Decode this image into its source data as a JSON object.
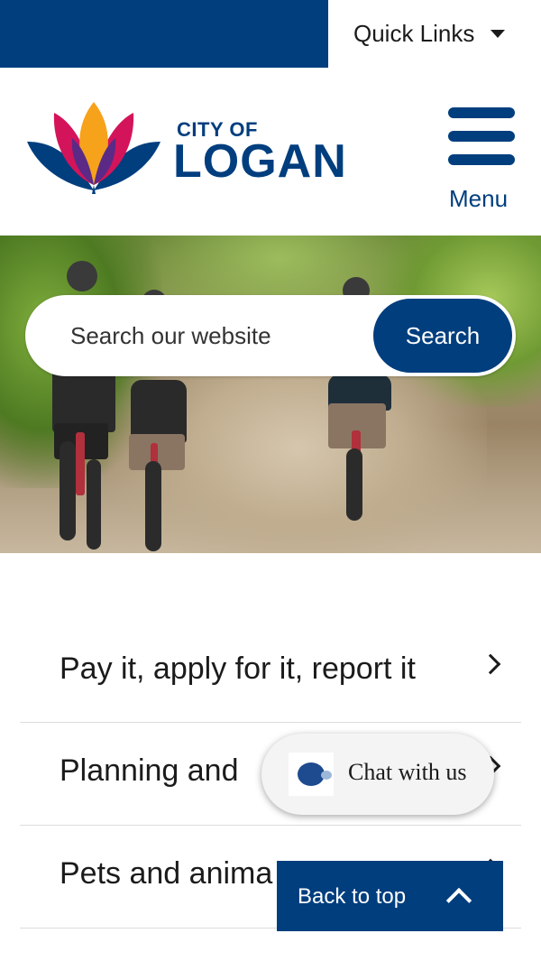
{
  "topbar": {
    "quick_links_label": "Quick Links"
  },
  "header": {
    "logo_city": "CITY OF",
    "logo_name": "LOGAN",
    "menu_label": "Menu"
  },
  "search": {
    "placeholder": "Search our website",
    "button_label": "Search"
  },
  "links": [
    {
      "label": "Pay it, apply for it, report it"
    },
    {
      "label": "Planning and"
    },
    {
      "label": "Pets and anima"
    }
  ],
  "chat": {
    "label": "Chat with us"
  },
  "back_to_top": {
    "label": "Back to top"
  },
  "colors": {
    "brand_blue": "#003e7e",
    "logo_pink": "#d4145a",
    "logo_orange": "#f7a21b",
    "logo_purple": "#5b2a86"
  }
}
